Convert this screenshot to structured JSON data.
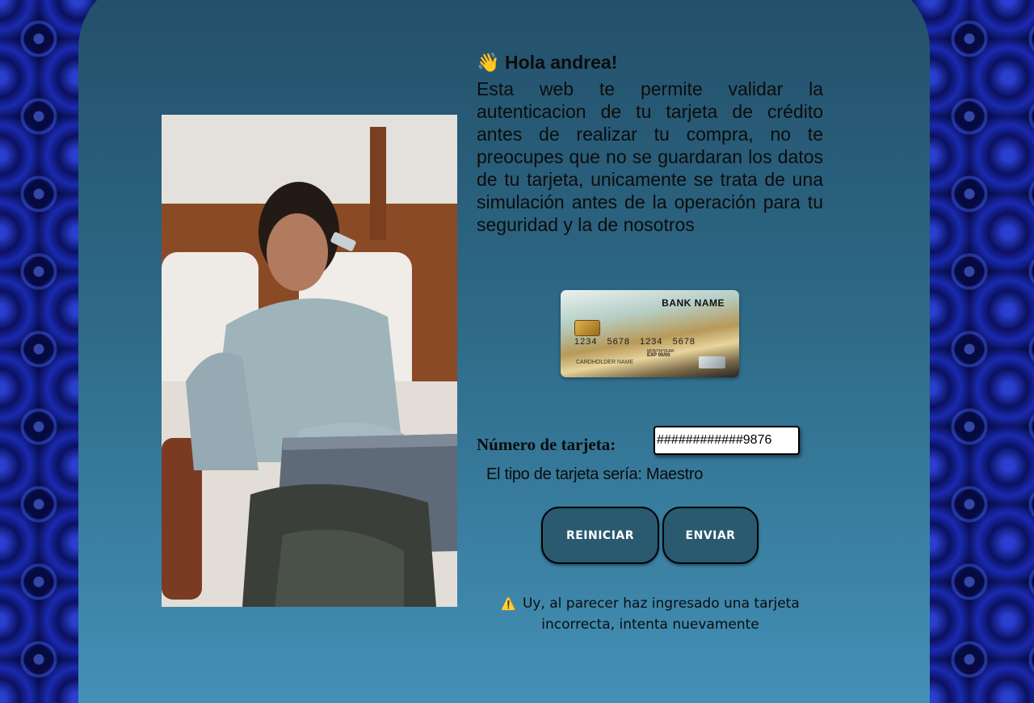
{
  "greeting": {
    "icon": "waving-hand-icon",
    "emoji": "👋",
    "text": "Hola andrea!"
  },
  "intro_text": "Esta web te permite validar la autenticacion de tu tarjeta de crédito antes de realizar tu compra, no te preocupes que no se guardaran los datos de tu tarjeta, unicamente se trata de una simulación antes de la operación para tu seguridad y la de nosotros",
  "credit_card": {
    "bank_name": "BANK NAME",
    "number": "1234 5678 1234 5678",
    "month_year_label": "MONTH/YEAR",
    "exp": "EXP 00/00",
    "holder": "CARDHOLDER NAME"
  },
  "form": {
    "card_number_label": "Número de tarjeta:",
    "card_number_value": "############9876",
    "card_type_text": "El tipo de tarjeta sería: Maestro"
  },
  "buttons": {
    "reset_label": "REINICIAR",
    "send_label": "ENVIAR"
  },
  "alert": {
    "icon": "warning-icon",
    "emoji": "⚠️",
    "line1": "Uy, al parecer haz ingresado una tarjeta",
    "line2": "incorrecta, intenta nuevamente"
  },
  "colors": {
    "panel_top": "#234e68",
    "panel_bottom": "#4390b6",
    "button_bg": "#2a5a70",
    "background": "#1a2a9a"
  }
}
